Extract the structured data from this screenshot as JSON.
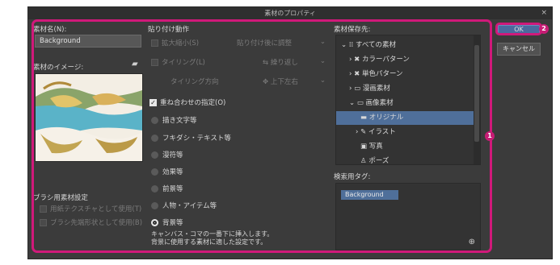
{
  "window": {
    "title": "素材のプロパティ",
    "close_glyph": "×"
  },
  "left": {
    "name_label": "素材名(N):",
    "name_value": "Background",
    "image_label": "素材のイメージ:",
    "brush_section_label": "ブラシ用素材設定",
    "brush_opt1": "用紙テクスチャとして使用(T)",
    "brush_opt2": "ブラシ先端形状として使用(B)"
  },
  "paste": {
    "section_label": "貼り付け動作",
    "scale_label": "拡大縮小(S)",
    "scale_value": "貼り付け後に調整",
    "tiling_label": "タイリング(L)",
    "tiling_value": "繰り返し",
    "tiling_dir_label": "タイリング方向",
    "tiling_dir_value": "上下左右",
    "overlay_label": "重ね合わせの指定(O)",
    "radios": [
      "描き文字等",
      "フキダシ・テキスト等",
      "漫符等",
      "効果等",
      "前景等",
      "人物・アイテム等",
      "背景等"
    ],
    "selected_radio": "背景等",
    "note_line1": "キャンバス・コマの一番下に挿入します。",
    "note_line2": "背景に使用する素材に適した設定です。"
  },
  "save": {
    "label": "素材保存先:",
    "items": [
      "すべての素材",
      "カラーパターン",
      "単色パターン",
      "漫画素材",
      "画像素材",
      "オリジナル",
      "イラスト",
      "写真",
      "ポーズ"
    ],
    "selected": "オリジナル"
  },
  "tags": {
    "label": "検索用タグ:",
    "values": [
      "Background"
    ]
  },
  "buttons": {
    "ok": "OK",
    "cancel": "キャンセル"
  },
  "badges": [
    "1",
    "2"
  ],
  "colors": {
    "highlight": "#d0197a",
    "selection": "#4f6f9a",
    "dialog_bg": "#3b3b3b"
  }
}
